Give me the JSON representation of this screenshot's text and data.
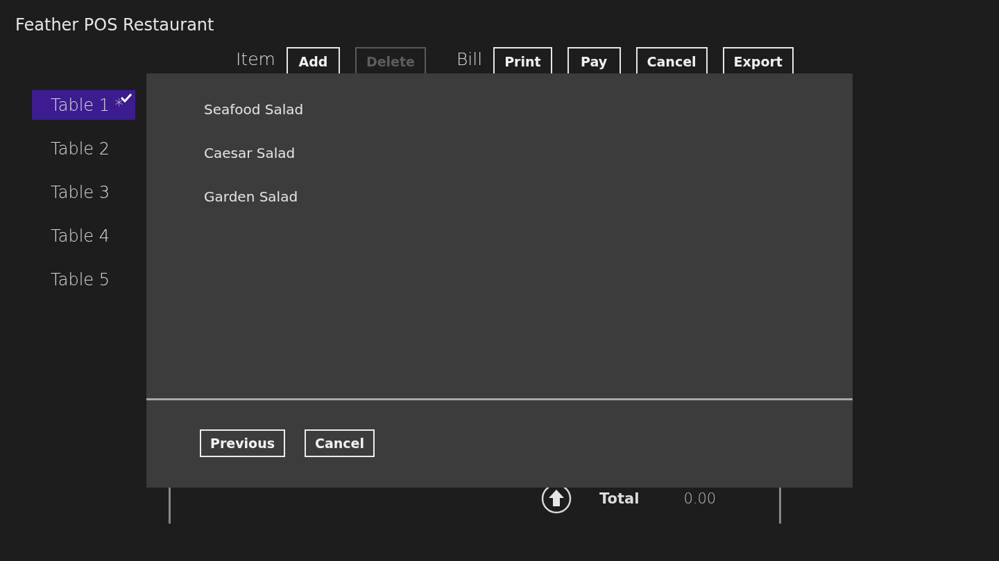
{
  "app_title": "Feather POS Restaurant",
  "toolbar": {
    "groups": [
      {
        "label": "Item",
        "buttons": [
          {
            "label": "Add",
            "disabled": false
          },
          {
            "label": "Delete",
            "disabled": true
          }
        ]
      },
      {
        "label": "Bill",
        "buttons": [
          {
            "label": "Print",
            "disabled": false
          },
          {
            "label": "Pay",
            "disabled": false
          },
          {
            "label": "Cancel",
            "disabled": false
          },
          {
            "label": "Export",
            "disabled": false
          }
        ]
      }
    ]
  },
  "tables": [
    {
      "label": "Table 1 *",
      "selected": true
    },
    {
      "label": "Table 2",
      "selected": false
    },
    {
      "label": "Table 3",
      "selected": false
    },
    {
      "label": "Table 4",
      "selected": false
    },
    {
      "label": "Table 5",
      "selected": false
    }
  ],
  "bill": {
    "total_label": "Total",
    "total": "0.00"
  },
  "dialog": {
    "items": [
      "Seafood Salad",
      "Caesar Salad",
      "Garden Salad"
    ],
    "buttons": [
      "Previous",
      "Cancel"
    ]
  }
}
